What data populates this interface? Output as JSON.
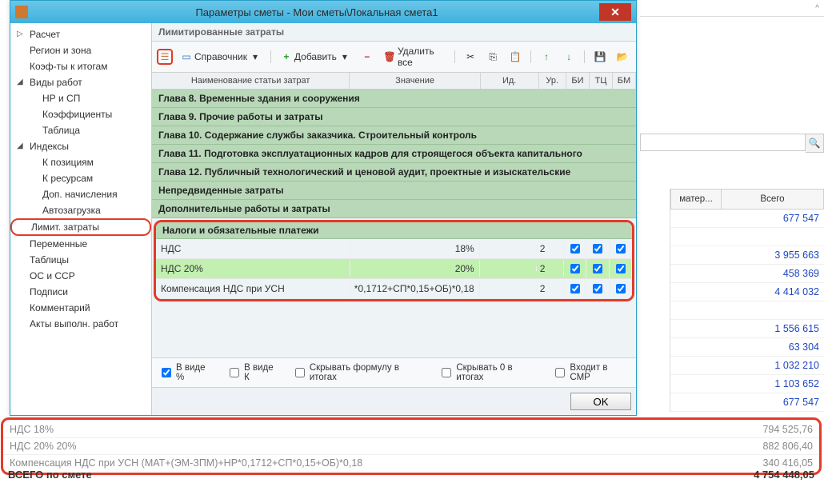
{
  "dialog": {
    "title": "Параметры сметы - Мои сметы\\Локальная смета1",
    "close": "✕"
  },
  "tree": [
    {
      "lvl": 0,
      "tw": "▷",
      "label": "Расчет"
    },
    {
      "lvl": 0,
      "tw": "",
      "label": "Регион и зона"
    },
    {
      "lvl": 0,
      "tw": "",
      "label": "Коэф-ты к итогам"
    },
    {
      "lvl": 0,
      "tw": "◢",
      "label": "Виды работ"
    },
    {
      "lvl": 1,
      "tw": "",
      "label": "НР и СП"
    },
    {
      "lvl": 1,
      "tw": "",
      "label": "Коэффициенты"
    },
    {
      "lvl": 1,
      "tw": "",
      "label": "Таблица"
    },
    {
      "lvl": 0,
      "tw": "◢",
      "label": "Индексы"
    },
    {
      "lvl": 1,
      "tw": "",
      "label": "К позициям"
    },
    {
      "lvl": 1,
      "tw": "",
      "label": "К ресурсам"
    },
    {
      "lvl": 1,
      "tw": "",
      "label": "Доп. начисления"
    },
    {
      "lvl": 1,
      "tw": "",
      "label": "Автозагрузка"
    },
    {
      "lvl": 0,
      "tw": "",
      "label": "Лимит. затраты",
      "boxed": true
    },
    {
      "lvl": 0,
      "tw": "",
      "label": "Переменные"
    },
    {
      "lvl": 0,
      "tw": "",
      "label": "Таблицы"
    },
    {
      "lvl": 0,
      "tw": "",
      "label": "ОС и ССР"
    },
    {
      "lvl": 0,
      "tw": "",
      "label": "Подписи"
    },
    {
      "lvl": 0,
      "tw": "",
      "label": "Комментарий"
    },
    {
      "lvl": 0,
      "tw": "",
      "label": "Акты выполн. работ"
    }
  ],
  "section_title": "Лимитированные затраты",
  "toolbar": {
    "ref": "Справочник",
    "add": "Добавить",
    "del_all": "Удалить все"
  },
  "cols": {
    "name": "Наименование статьи затрат",
    "value": "Значение",
    "id": "Ид.",
    "ur": "Ур.",
    "bi": "БИ",
    "tc": "ТЦ",
    "bm": "БМ"
  },
  "chapters": [
    "Глава 8. Временные здания и сооружения",
    "Глава 9. Прочие работы и затраты",
    "Глава 10. Содержание службы заказчика. Строительный контроль",
    "Глава 11. Подготовка эксплуатационных кадров для строящегося объекта капитального",
    "Глава 12. Публичный технологический и ценовой аудит, проектные и изыскательские",
    "Непредвиденные затраты",
    "Дополнительные работы и затраты"
  ],
  "tax_head": "Налоги и обязательные платежи",
  "tax_rows": [
    {
      "name": "НДС",
      "value": "18%",
      "ur": "2",
      "hl": false
    },
    {
      "name": "НДС 20%",
      "value": "20%",
      "ur": "2",
      "hl": true
    },
    {
      "name": "Компенсация НДС при УСН",
      "value": "*0,1712+СП*0,15+ОБ)*0,18",
      "ur": "2",
      "hl": false
    }
  ],
  "foot": {
    "as_percent": "В виде %",
    "as_coef": "В виде К",
    "hide_formula": "Скрывать формулу в итогах",
    "hide_zero": "Скрывать 0 в итогах",
    "in_smr": "Входит в СМР"
  },
  "ok": "OK",
  "totals": {
    "h1": "матер...",
    "h2": "Всего",
    "rows": [
      "677 547",
      "",
      "3 955 663",
      "458 369",
      "4 414 032",
      "",
      "1 556 615",
      "63 304",
      "1 032 210",
      "1 103 652",
      "677 547"
    ]
  },
  "summary": [
    {
      "lbl": "НДС 18%",
      "val": "794 525,76"
    },
    {
      "lbl": "НДС 20% 20%",
      "val": "882 806,40"
    },
    {
      "lbl": "Компенсация НДС при УСН (МАТ+(ЭМ-ЗПМ)+НР*0,1712+СП*0,15+ОБ)*0,18",
      "val": "340 416,05"
    }
  ],
  "grand": {
    "lbl": "ВСЕГО по смете",
    "val": "4 754 448,05"
  }
}
